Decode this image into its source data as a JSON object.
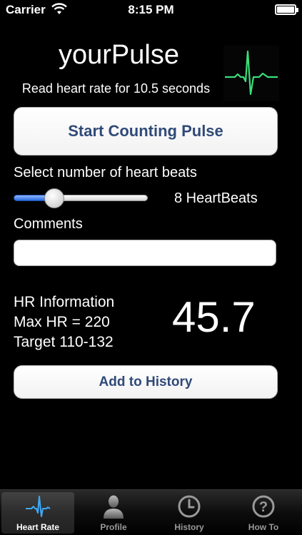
{
  "status_bar": {
    "carrier": "Carrier",
    "time": "8:15 PM",
    "wifi_icon": "wifi-icon",
    "battery_icon": "battery-full-icon"
  },
  "header": {
    "title": "yourPulse",
    "subtitle": "Read heart rate for 10.5 seconds",
    "logo_icon": "ecg-waveform-icon",
    "ecg_color": "#39e07a"
  },
  "start_button_label": "Start Counting Pulse",
  "heartbeats": {
    "label": "Select number of heart beats",
    "value_text": "8 HeartBeats",
    "slider_fraction": 0.27
  },
  "comments": {
    "label": "Comments",
    "value": "",
    "placeholder": ""
  },
  "hr_info": {
    "heading": "HR Information",
    "max_hr": "Max HR = 220",
    "target": "Target 110-132",
    "value": "45.7"
  },
  "add_history_label": "Add to History",
  "tabs": [
    {
      "label": "Heart Rate",
      "icon": "heartbeat-icon",
      "active": true
    },
    {
      "label": "Profile",
      "icon": "person-icon",
      "active": false
    },
    {
      "label": "History",
      "icon": "clock-icon",
      "active": false
    },
    {
      "label": "How To",
      "icon": "question-icon",
      "active": false
    }
  ],
  "colors": {
    "background": "#000000",
    "button_text": "#304a78",
    "slider_fill": "#2a6de0",
    "tab_active_icon": "#3fa9f5"
  }
}
